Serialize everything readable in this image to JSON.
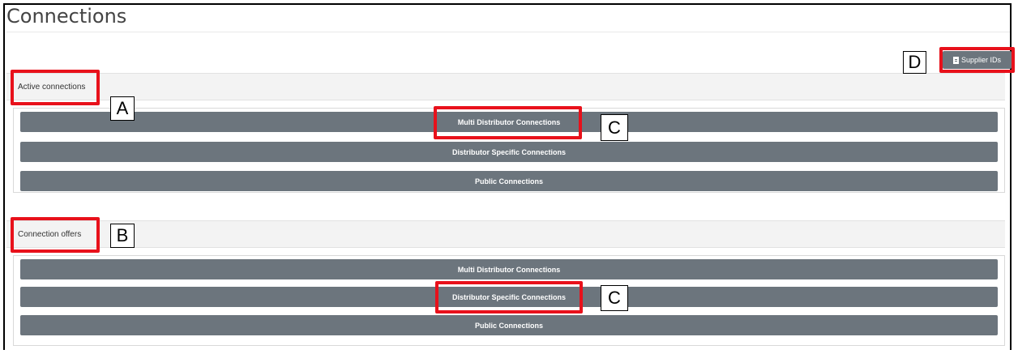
{
  "page": {
    "title": "Connections"
  },
  "header": {
    "supplier_ids_label": "Supplier IDs"
  },
  "sections": [
    {
      "label": "Active connections",
      "buttons": [
        "Multi Distributor Connections",
        "Distributor Specific Connections",
        "Public Connections"
      ]
    },
    {
      "label": "Connection offers",
      "buttons": [
        "Multi Distributor Connections",
        "Distributor Specific Connections",
        "Public Connections"
      ]
    }
  ],
  "annotations": {
    "a": "A",
    "b": "B",
    "c1": "C",
    "c2": "C",
    "d": "D"
  },
  "colors": {
    "button_bg": "#6c757d",
    "highlight": "#e8111b",
    "header_bg": "#f3f3f3"
  },
  "icons": {
    "supplier_ids": "document-icon"
  }
}
